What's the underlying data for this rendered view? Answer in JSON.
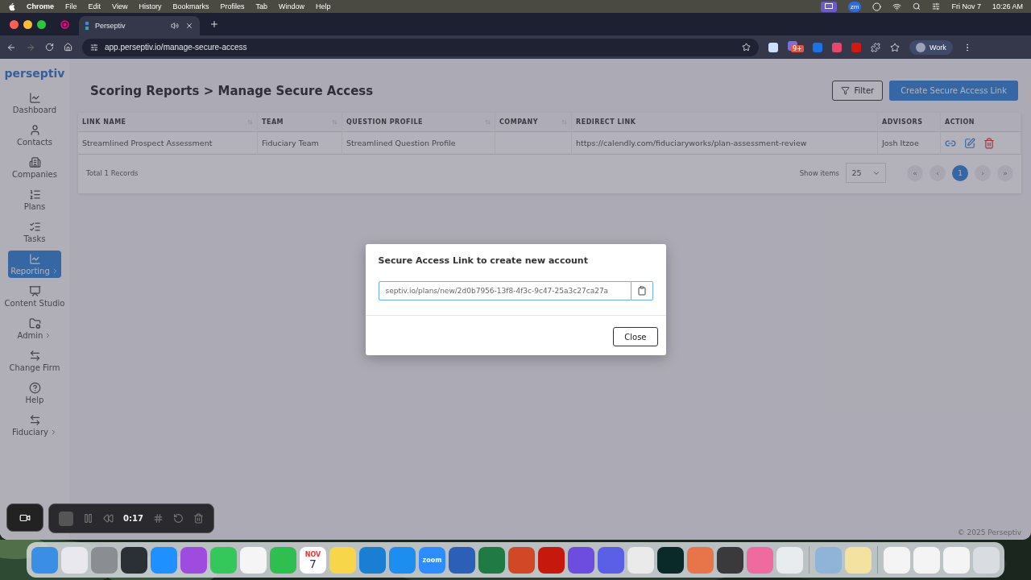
{
  "menubar": {
    "app": "Chrome",
    "menus": [
      "File",
      "Edit",
      "View",
      "History",
      "Bookmarks",
      "Profiles",
      "Tab",
      "Window",
      "Help"
    ],
    "status_badge": "zm",
    "date": "Fri Nov 7",
    "time": "10:26 AM"
  },
  "browser": {
    "tab": {
      "title": "Perseptiv"
    },
    "url": "app.perseptiv.io/manage-secure-access",
    "extension_badge": "9+",
    "profile": "Work"
  },
  "sidebar": {
    "logo": "perseptiv",
    "items": [
      {
        "label": "Dashboard",
        "kind": "chart",
        "selected": false,
        "submenu": false
      },
      {
        "label": "Contacts",
        "kind": "user",
        "selected": false,
        "submenu": false
      },
      {
        "label": "Companies",
        "kind": "building",
        "selected": false,
        "submenu": false
      },
      {
        "label": "Plans",
        "kind": "list",
        "selected": false,
        "submenu": false
      },
      {
        "label": "Tasks",
        "kind": "tasks",
        "selected": false,
        "submenu": false
      },
      {
        "label": "Reporting",
        "kind": "chart",
        "selected": true,
        "submenu": true
      },
      {
        "label": "Content Studio",
        "kind": "presentation",
        "selected": false,
        "submenu": false
      },
      {
        "label": "Admin",
        "kind": "folder",
        "selected": false,
        "submenu": true
      },
      {
        "label": "Change Firm",
        "kind": "swap",
        "selected": false,
        "submenu": false
      },
      {
        "label": "Help",
        "kind": "help",
        "selected": false,
        "submenu": false
      },
      {
        "label": "Fiduciary",
        "kind": "swap",
        "selected": false,
        "submenu": true
      }
    ]
  },
  "header": {
    "breadcrumb": "Scoring Reports > Manage Secure Access",
    "filter_button": "Filter",
    "create_button": "Create Secure Access Link"
  },
  "table": {
    "columns": [
      {
        "label": "LINK NAME",
        "sortable": true
      },
      {
        "label": "TEAM",
        "sortable": true
      },
      {
        "label": "QUESTION PROFILE",
        "sortable": true
      },
      {
        "label": "COMPANY",
        "sortable": true
      },
      {
        "label": "REDIRECT LINK",
        "sortable": false
      },
      {
        "label": "ADVISORS",
        "sortable": false
      },
      {
        "label": "ACTION",
        "sortable": false
      }
    ],
    "rows": [
      {
        "link_name": "Streamlined Prospect Assessment",
        "team": "Fiduciary Team",
        "question_profile": "Streamlined Question Profile",
        "redirect_link": "https://calendly.com/fiduciaryworks/plan-assessment-review",
        "advisors": "Josh Itzoe"
      }
    ],
    "total": "Total 1 Records",
    "show_items": "Show items",
    "page_size": "25",
    "pages": [
      {
        "label": "«",
        "selected": false
      },
      {
        "label": "‹",
        "selected": false
      },
      {
        "label": "1",
        "selected": true
      },
      {
        "label": "›",
        "selected": false
      },
      {
        "label": "»",
        "selected": false
      }
    ]
  },
  "modal": {
    "title": "Secure Access Link to create new account",
    "link": "septiv.io/plans/new/2d0b7956-13f8-4f3c-9c47-25a3c27ca27a",
    "close_button": "Close"
  },
  "footer": {
    "copyright": "© 2025 Perseptiv"
  },
  "recorder": {
    "time": "0:17"
  },
  "dock": {
    "items": [
      {
        "kind": "finder"
      },
      {
        "kind": "launchpad"
      },
      {
        "kind": "settings"
      },
      {
        "kind": "monitor"
      },
      {
        "kind": "compass"
      },
      {
        "kind": "podcast"
      },
      {
        "kind": "messages"
      },
      {
        "kind": "photos"
      },
      {
        "kind": "video"
      },
      {
        "kind": "calendar",
        "month": "NOV",
        "day": "7"
      },
      {
        "kind": "notes"
      },
      {
        "kind": "browser"
      },
      {
        "kind": "store"
      },
      {
        "kind": "meeting",
        "label": "zoom"
      },
      {
        "kind": "doc"
      },
      {
        "kind": "sheet"
      },
      {
        "kind": "slides"
      },
      {
        "kind": "pdf"
      },
      {
        "kind": "purple"
      },
      {
        "kind": "gear"
      },
      {
        "kind": "text"
      },
      {
        "kind": "teal"
      },
      {
        "kind": "spark"
      },
      {
        "kind": "calculator"
      },
      {
        "kind": "beta"
      },
      {
        "kind": "chrome"
      },
      {
        "kind": "separator"
      },
      {
        "kind": "preview"
      },
      {
        "kind": "script"
      },
      {
        "kind": "separator"
      },
      {
        "kind": "window"
      },
      {
        "kind": "window"
      },
      {
        "kind": "window"
      },
      {
        "kind": "trash"
      }
    ]
  }
}
